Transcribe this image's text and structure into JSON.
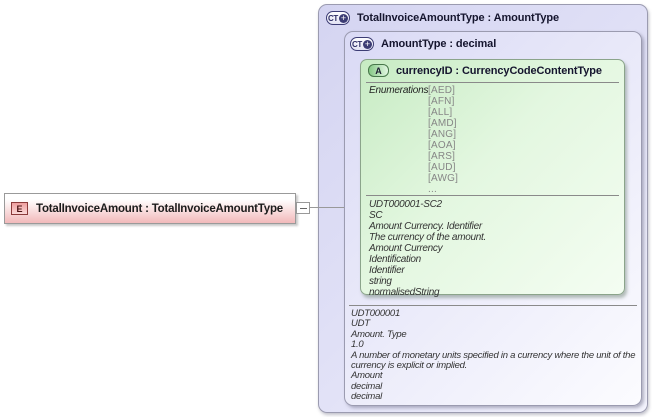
{
  "diagram": {
    "element": {
      "icon": "E",
      "label": "TotalInvoiceAmount : TotalInvoiceAmountType"
    },
    "outer_type": {
      "icon": "CT",
      "plus": "+",
      "label": "TotalInvoiceAmountType : AmountType"
    },
    "inner_type": {
      "icon": "CT",
      "plus": "+",
      "label": "AmountType : decimal",
      "doc_lines": [
        "UDT000001",
        "UDT",
        "Amount. Type",
        "1.0",
        "A number of monetary units specified in a currency where the unit of the currency is explicit or implied.",
        "Amount",
        "decimal",
        "decimal"
      ]
    },
    "attribute": {
      "icon": "A",
      "label": "currencyID : CurrencyCodeContentType",
      "enumerations_label": "Enumerations",
      "enumerations": [
        "[AED]",
        "[AFN]",
        "[ALL]",
        "[AMD]",
        "[ANG]",
        "[AOA]",
        "[ARS]",
        "[AUD]",
        "[AWG]",
        "..."
      ],
      "doc_lines": [
        "UDT000001-SC2",
        "SC",
        "Amount Currency. Identifier",
        "The currency of the amount.",
        "Amount Currency",
        "Identification",
        "Identifier",
        "string",
        "normalisedString"
      ]
    },
    "colors": {
      "element_pink": "#f2b9ba",
      "element_icon_border": "#8b3a3a",
      "type_lavender": "#d6d6f3",
      "type_icon_navy": "#3c3c74",
      "attribute_green": "#c7ebc3",
      "attribute_icon_green": "#47764a",
      "border_gray": "#999999",
      "enum_text_gray": "#868686"
    }
  }
}
